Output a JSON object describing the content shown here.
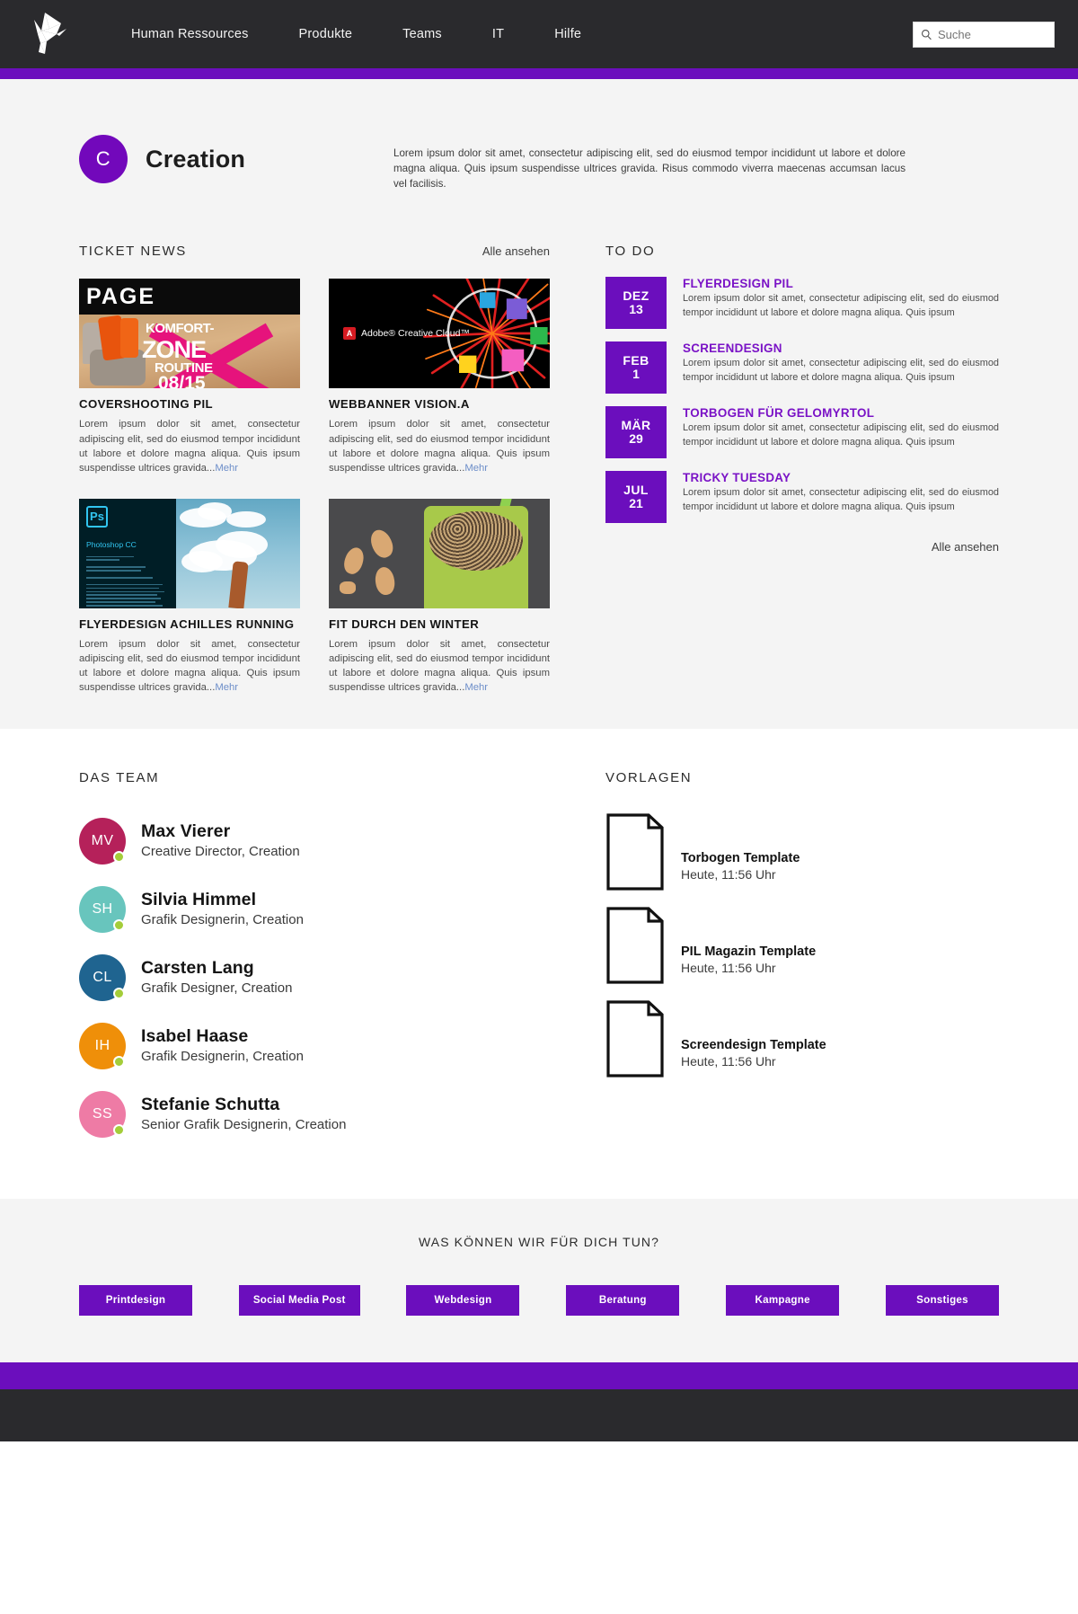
{
  "header": {
    "logo_name": "origami-bird-logo",
    "nav": [
      {
        "label": "Human Ressources"
      },
      {
        "label": "Produkte"
      },
      {
        "label": "Teams"
      },
      {
        "label": "IT"
      },
      {
        "label": "Hilfe"
      }
    ],
    "search": {
      "placeholder": "Suche",
      "value": "",
      "icon": "search-icon"
    },
    "accent_color": "#6b0ebd",
    "bg_color": "#2a2a2d"
  },
  "hero": {
    "badge_letter": "C",
    "badge_color": "#7208bb",
    "title": "Creation",
    "description": "Lorem ipsum dolor sit amet, consectetur adipiscing elit, sed do eiusmod tempor incididunt ut labore et dolore magna aliqua. Quis ipsum suspendisse ultrices gravida. Risus commodo viverra maecenas accumsan lacus vel facilisis."
  },
  "news": {
    "section_title": "TICKET NEWS",
    "see_all": "Alle ansehen",
    "cards": [
      {
        "title": "COVERSHOOTING PIL",
        "body": "Lorem ipsum dolor sit amet, consectetur adipiscing elit, sed do eiusmod tempor incididunt ut labore et dolore magna aliqua. Quis ipsum suspendisse ultrices gravida...",
        "more": "Mehr",
        "image_name": "page-komfortzone-cover",
        "image_texts": {
          "brand": "PAGE",
          "line1": "KOMFORT-",
          "line2": "ZONE",
          "line3": "ROUTINE",
          "line4": "08/15"
        }
      },
      {
        "title": "WEBBANNER VISION.A",
        "body": "Lorem ipsum dolor sit amet, consectetur adipiscing elit, sed do eiusmod tempor incididunt ut labore et dolore magna aliqua. Quis ipsum suspendisse ultrices gravida...",
        "more": "Mehr",
        "image_name": "adobe-creative-cloud-banner",
        "image_texts": {
          "brand": "Adobe® Creative Cloud™",
          "mark": "A"
        }
      },
      {
        "title": "FLYERDESIGN ACHILLES RUNNING",
        "body": "Lorem ipsum dolor sit amet, consectetur adipiscing elit, sed do eiusmod tempor incididunt ut labore et dolore magna aliqua. Quis ipsum suspendisse ultrices gravida...",
        "more": "Mehr",
        "image_name": "photoshop-splash-cloud",
        "image_texts": {
          "mark": "Ps",
          "app": "Photoshop CC"
        }
      },
      {
        "title": "FIT DURCH DEN WINTER",
        "body": "Lorem ipsum dolor sit amet, consectetur adipiscing elit, sed do eiusmod tempor incididunt ut labore et dolore magna aliqua. Quis ipsum suspendisse ultrices gravida...",
        "more": "Mehr",
        "image_name": "smoothie-almonds-photo",
        "image_texts": {}
      }
    ]
  },
  "todo": {
    "section_title": "TO DO",
    "see_all": "Alle ansehen",
    "date_color": "#6b0ebd",
    "title_color": "#7a13c6",
    "items": [
      {
        "month": "DEZ",
        "day": "13",
        "title": "FLYERDESIGN PIL",
        "body": "Lorem ipsum dolor sit amet, consectetur adipiscing elit, sed do eiusmod tempor incididunt ut labore et dolore magna aliqua. Quis ipsum"
      },
      {
        "month": "FEB",
        "day": "1",
        "title": "SCREENDESIGN",
        "body": "Lorem ipsum dolor sit amet, consectetur adipiscing elit, sed do eiusmod tempor incididunt ut labore et dolore magna aliqua. Quis ipsum"
      },
      {
        "month": "MÄR",
        "day": "29",
        "title": "TORBOGEN FÜR GELOMYRTOL",
        "body": "Lorem ipsum dolor sit amet, consectetur adipiscing elit, sed do eiusmod tempor incididunt ut labore et dolore magna aliqua. Quis ipsum"
      },
      {
        "month": "JUL",
        "day": "21",
        "title": "TRICKY TUESDAY",
        "body": "Lorem ipsum dolor sit amet, consectetur adipiscing elit, sed do eiusmod tempor incididunt ut labore et dolore magna aliqua. Quis ipsum"
      }
    ]
  },
  "team": {
    "section_title": "DAS TEAM",
    "status_color": "#a4cd39",
    "members": [
      {
        "initials": "MV",
        "name": "Max Vierer",
        "role": "Creative Director, Creation",
        "color": "#b5215a"
      },
      {
        "initials": "SH",
        "name": "Silvia Himmel",
        "role": "Grafik Designerin, Creation",
        "color": "#68c5bd"
      },
      {
        "initials": "CL",
        "name": "Carsten Lang",
        "role": "Grafik Designer, Creation",
        "color": "#1f6490"
      },
      {
        "initials": "IH",
        "name": "Isabel  Haase",
        "role": "Grafik Designerin, Creation",
        "color": "#ef8f09"
      },
      {
        "initials": "SS",
        "name": "Stefanie Schutta",
        "role": "Senior Grafik Designerin, Creation",
        "color": "#ee7ba5"
      }
    ]
  },
  "templates": {
    "section_title": "VORLAGEN",
    "items": [
      {
        "name": "Torbogen Template",
        "time": "Heute, 11:56 Uhr",
        "icon": "document-icon"
      },
      {
        "name": "PIL Magazin Template",
        "time": "Heute, 11:56 Uhr",
        "icon": "document-icon"
      },
      {
        "name": "Screendesign Template",
        "time": "Heute, 11:56 Uhr",
        "icon": "document-icon"
      }
    ]
  },
  "cta": {
    "title": "WAS KÖNNEN WIR FÜR DICH TUN?",
    "button_color": "#6b0ebd",
    "buttons": [
      {
        "label": "Printdesign"
      },
      {
        "label": "Social Media Post"
      },
      {
        "label": "Webdesign"
      },
      {
        "label": "Beratung"
      },
      {
        "label": "Kampagne"
      },
      {
        "label": "Sonstiges"
      }
    ]
  }
}
